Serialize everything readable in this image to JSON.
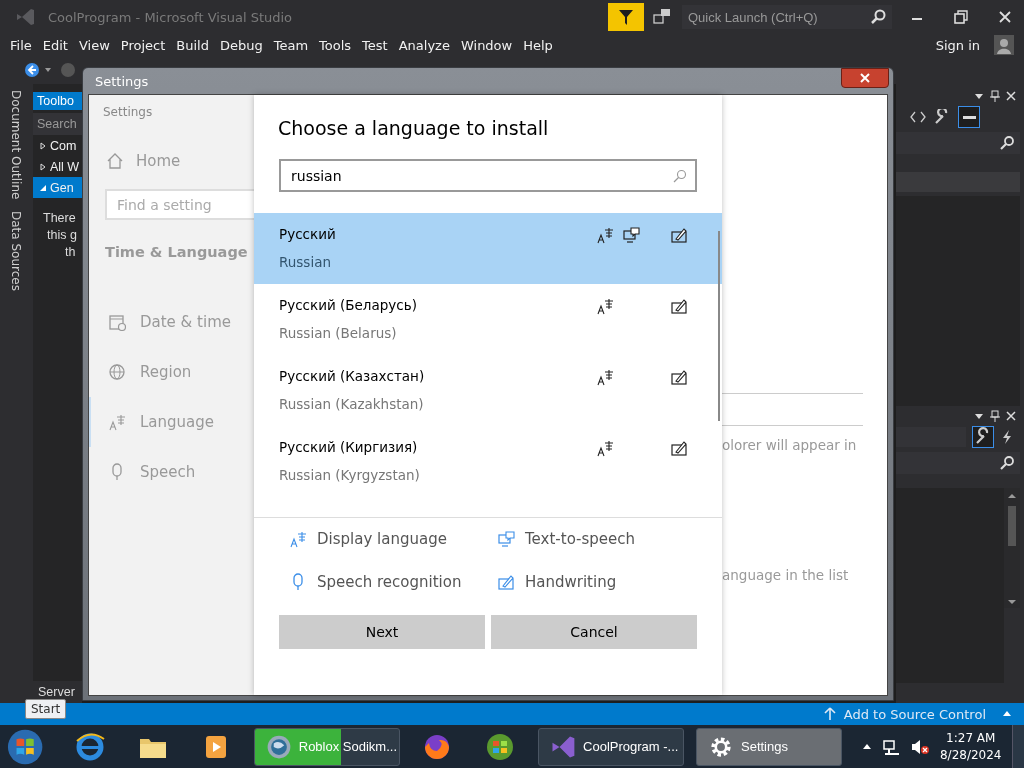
{
  "vs_window": {
    "title": "CoolProgram - Microsoft Visual Studio",
    "quick_launch": {
      "placeholder": "Quick Launch (Ctrl+Q)"
    },
    "menu": [
      "File",
      "Edit",
      "View",
      "Project",
      "Build",
      "Debug",
      "Team",
      "Tools",
      "Test",
      "Analyze",
      "Window",
      "Help"
    ],
    "sign_in": "Sign in",
    "side_tabs": [
      "Document Outline",
      "Data Sources"
    ],
    "toolbox": {
      "title": "Toolbo",
      "search": {
        "placeholder": "Search"
      },
      "items": [
        {
          "label": "Com",
          "expanded": false,
          "selected": false
        },
        {
          "label": "All W",
          "expanded": false,
          "selected": false
        },
        {
          "label": "Gen",
          "expanded": true,
          "selected": true
        }
      ],
      "message_lines": [
        "There",
        "this g",
        "th"
      ],
      "bottom_tab": "Server"
    },
    "status_bar": {
      "source_control": "Add to Source Control"
    }
  },
  "settings_window": {
    "title": "Settings",
    "app_title": "Settings",
    "nav": {
      "home": "Home",
      "search": {
        "placeholder": "Find a setting"
      },
      "section": "Time & Language",
      "items": [
        {
          "label": "Date & time",
          "selected": false
        },
        {
          "label": "Region",
          "selected": false
        },
        {
          "label": "Language",
          "selected": true
        },
        {
          "label": "Speech",
          "selected": false
        }
      ]
    },
    "background_texts": [
      "olorer will appear in",
      "anguage in the list"
    ],
    "dialog": {
      "title": "Choose a language to install",
      "search": {
        "value": "russian"
      },
      "languages": [
        {
          "native": "Русский",
          "english": "Russian",
          "selected": true,
          "display_language": true,
          "text_to_speech": true,
          "handwriting": true
        },
        {
          "native": "Русский (Беларусь)",
          "english": "Russian (Belarus)",
          "selected": false,
          "display_language": true,
          "text_to_speech": false,
          "handwriting": true
        },
        {
          "native": "Русский (Казахстан)",
          "english": "Russian (Kazakhstan)",
          "selected": false,
          "display_language": true,
          "text_to_speech": false,
          "handwriting": true
        },
        {
          "native": "Русский (Киргизия)",
          "english": "Russian (Kyrgyzstan)",
          "selected": false,
          "display_language": true,
          "text_to_speech": false,
          "handwriting": true
        }
      ],
      "legend": [
        "Display language",
        "Text-to-speech",
        "Speech recognition",
        "Handwriting"
      ],
      "buttons": [
        "Next",
        "Cancel"
      ]
    }
  },
  "taskbar": {
    "start_tooltip": "Start",
    "items": [
      {
        "kind": "pinned"
      },
      {
        "kind": "pinned"
      },
      {
        "kind": "pinned"
      },
      {
        "kind": "window",
        "label": "Roblox Sodikm...",
        "selected": false,
        "level": 0.6
      },
      {
        "kind": "pinned"
      },
      {
        "kind": "pinned"
      },
      {
        "kind": "window",
        "label": "CoolProgram -...",
        "selected": false
      },
      {
        "kind": "window",
        "label": "Settings",
        "selected": true
      }
    ],
    "volume_muted": true,
    "time": "1:27 AM",
    "date": "8/28/2024"
  }
}
